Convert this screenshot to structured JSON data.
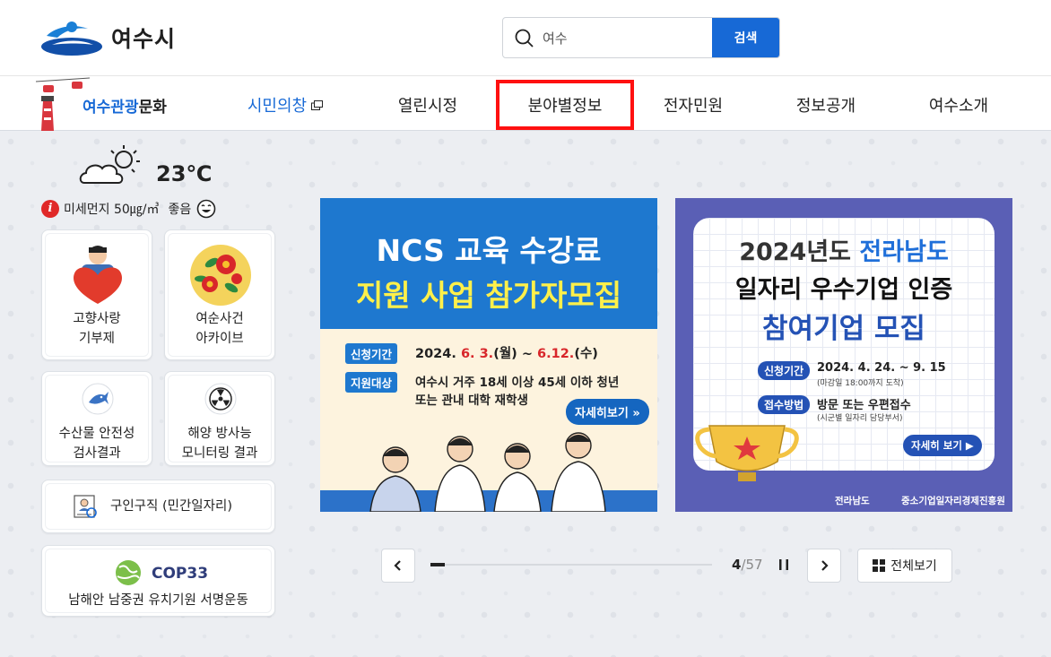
{
  "header": {
    "logo_text": "여수시",
    "search": {
      "value": "여수",
      "button_label": "검색"
    }
  },
  "gnb": {
    "tour_part1": "여수관광",
    "tour_part2": "문화",
    "items": [
      {
        "label": "시민의창"
      },
      {
        "label": "열린시정"
      },
      {
        "label": "분야별정보"
      },
      {
        "label": "전자민원"
      },
      {
        "label": "정보공개"
      },
      {
        "label": "여수소개"
      }
    ]
  },
  "weather": {
    "temp": "23℃",
    "dust_label": "미세먼지 50㎍/㎥",
    "dust_status": "좋음"
  },
  "tiles": {
    "hometown": {
      "line1": "고향사랑",
      "line2": "기부제"
    },
    "archive": {
      "line1": "여순사건",
      "line2": "아카이브"
    },
    "seafood": {
      "line1": "수산물 안전성",
      "line2": "검사결과"
    },
    "radiation": {
      "line1": "해양 방사능",
      "line2": "모니터링 결과"
    },
    "jobs": {
      "label": "구인구직 (민간일자리)"
    },
    "cop": {
      "logo": "COP33",
      "label": "남해안 남중권 유치기원 서명운동"
    }
  },
  "banner1": {
    "title1": "NCS 교육 수강료",
    "title2": "지원 사업 참가자모집",
    "tag1": "신청기간",
    "period_a": "2024.",
    "period_b": "6. 3.",
    "period_c": "(월) ~ ",
    "period_d": "6.12.",
    "period_e": "(수)",
    "tag2": "지원대상",
    "target1": "여수시 거주 18세 이상 45세 이하 청년",
    "target2": "또는 관내 대학 재학생",
    "more": "자세히보기 »"
  },
  "banner2": {
    "line1a": "2024년도 ",
    "line1b": "전라남도",
    "line2": "일자리 우수기업 인증",
    "line3": "참여기업 모집",
    "tag1": "신청기간",
    "period": "2024. 4. 24. ~ 9. 15",
    "period_sub": "(마감일 18:00까지 도착)",
    "tag2": "접수방법",
    "method": "방문 또는 우편접수",
    "method_sub": "(시군별 일자리 담당부서)",
    "more": "자세히 보기 ▶",
    "foot1": "전라남도",
    "foot2": "중소기업일자리경제진흥원"
  },
  "slider": {
    "current": "4",
    "total": "57",
    "progress": 0.05,
    "viewall_label": "전체보기"
  },
  "colors": {
    "brand_blue": "#1769d6",
    "highlight_red": "#ff1010"
  }
}
